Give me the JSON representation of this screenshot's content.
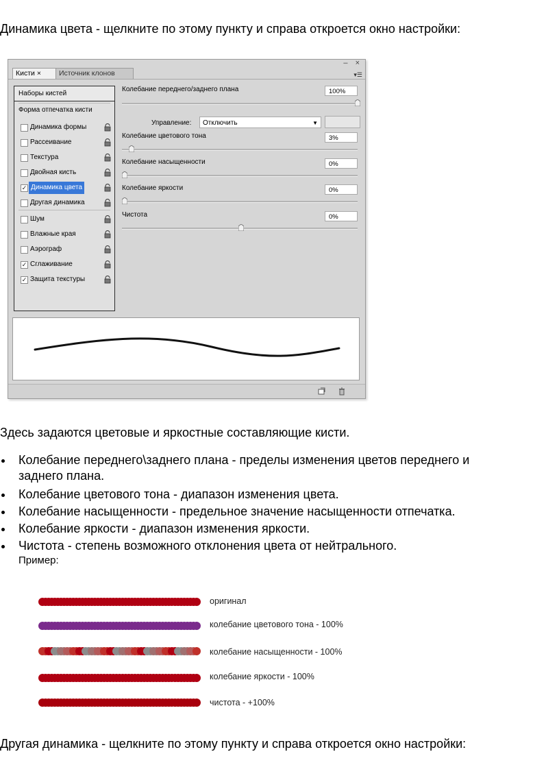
{
  "intro": "Динамика цвета - щелкните по этому пункту и справа откроется окно настройки:",
  "panel": {
    "window_buttons": "– ×",
    "tabs": [
      {
        "label": "Кисти ×"
      },
      {
        "label": "Источник клонов"
      }
    ],
    "presets_button": "Наборы кистей",
    "shape_label": "Форма отпечатка кисти",
    "options": [
      {
        "label": "Динамика формы",
        "checked": false,
        "selected": false
      },
      {
        "label": "Рассеивание",
        "checked": false,
        "selected": false
      },
      {
        "label": "Текстура",
        "checked": false,
        "selected": false
      },
      {
        "label": "Двойная кисть",
        "checked": false,
        "selected": false
      },
      {
        "label": "Динамика цвета",
        "checked": true,
        "selected": true
      },
      {
        "label": "Другая динамика",
        "checked": false,
        "selected": false
      },
      {
        "label": "Шум",
        "checked": false,
        "selected": false
      },
      {
        "label": "Влажные края",
        "checked": false,
        "selected": false
      },
      {
        "label": "Аэрограф",
        "checked": false,
        "selected": false
      },
      {
        "label": "Сглаживание",
        "checked": true,
        "selected": false
      },
      {
        "label": "Защита текстуры",
        "checked": true,
        "selected": false
      }
    ],
    "settings": {
      "fg_bg_jitter": {
        "label": "Колебание переднего/заднего плана",
        "value": "100%",
        "level": 1.0
      },
      "control_label": "Управление:",
      "control_value": "Отключить",
      "hue_jitter": {
        "label": "Колебание цветового тона",
        "value": "3%",
        "level": 0.03
      },
      "saturation_jitter": {
        "label": "Колебание насыщенности",
        "value": "0%",
        "level": 0.0
      },
      "brightness_jitter": {
        "label": "Колебание яркости",
        "value": "0%",
        "level": 0.0
      },
      "purity": {
        "label": "Чистота",
        "value": "0%",
        "level": 0.5
      }
    }
  },
  "description": "Здесь задаются цветовые и яркостные составляющие кисти.",
  "bullets": [
    {
      "line1": "Колебание переднего\\заднего плана - пределы изменения цветов переднего и",
      "line2": "заднего плана."
    },
    {
      "line1": "Колебание цветового тона - диапазон изменения цвета."
    },
    {
      "line1": "Колебание насыщенности - предельное значение насыщенности отпечатка."
    },
    {
      "line1": "Колебание яркости - диапазон изменения яркости."
    },
    {
      "line1": "Чистота - степень возможного отклонения цвета от нейтрального."
    }
  ],
  "example_label": "Пример:",
  "examples": [
    {
      "label": "оригинал"
    },
    {
      "label": "колебание цветового тона - 100%"
    },
    {
      "label": "колебание насыщенности - 100%"
    },
    {
      "label": "колебание яркости - 100%"
    },
    {
      "label": "чистота - +100%"
    }
  ],
  "outro": "Другая динамика - щелкните по этому пункту и справа откроется окно настройки:",
  "colors": {
    "selection": "#3878d8",
    "brush_red": "#b00012",
    "panel_bg": "#d6d6d6"
  }
}
